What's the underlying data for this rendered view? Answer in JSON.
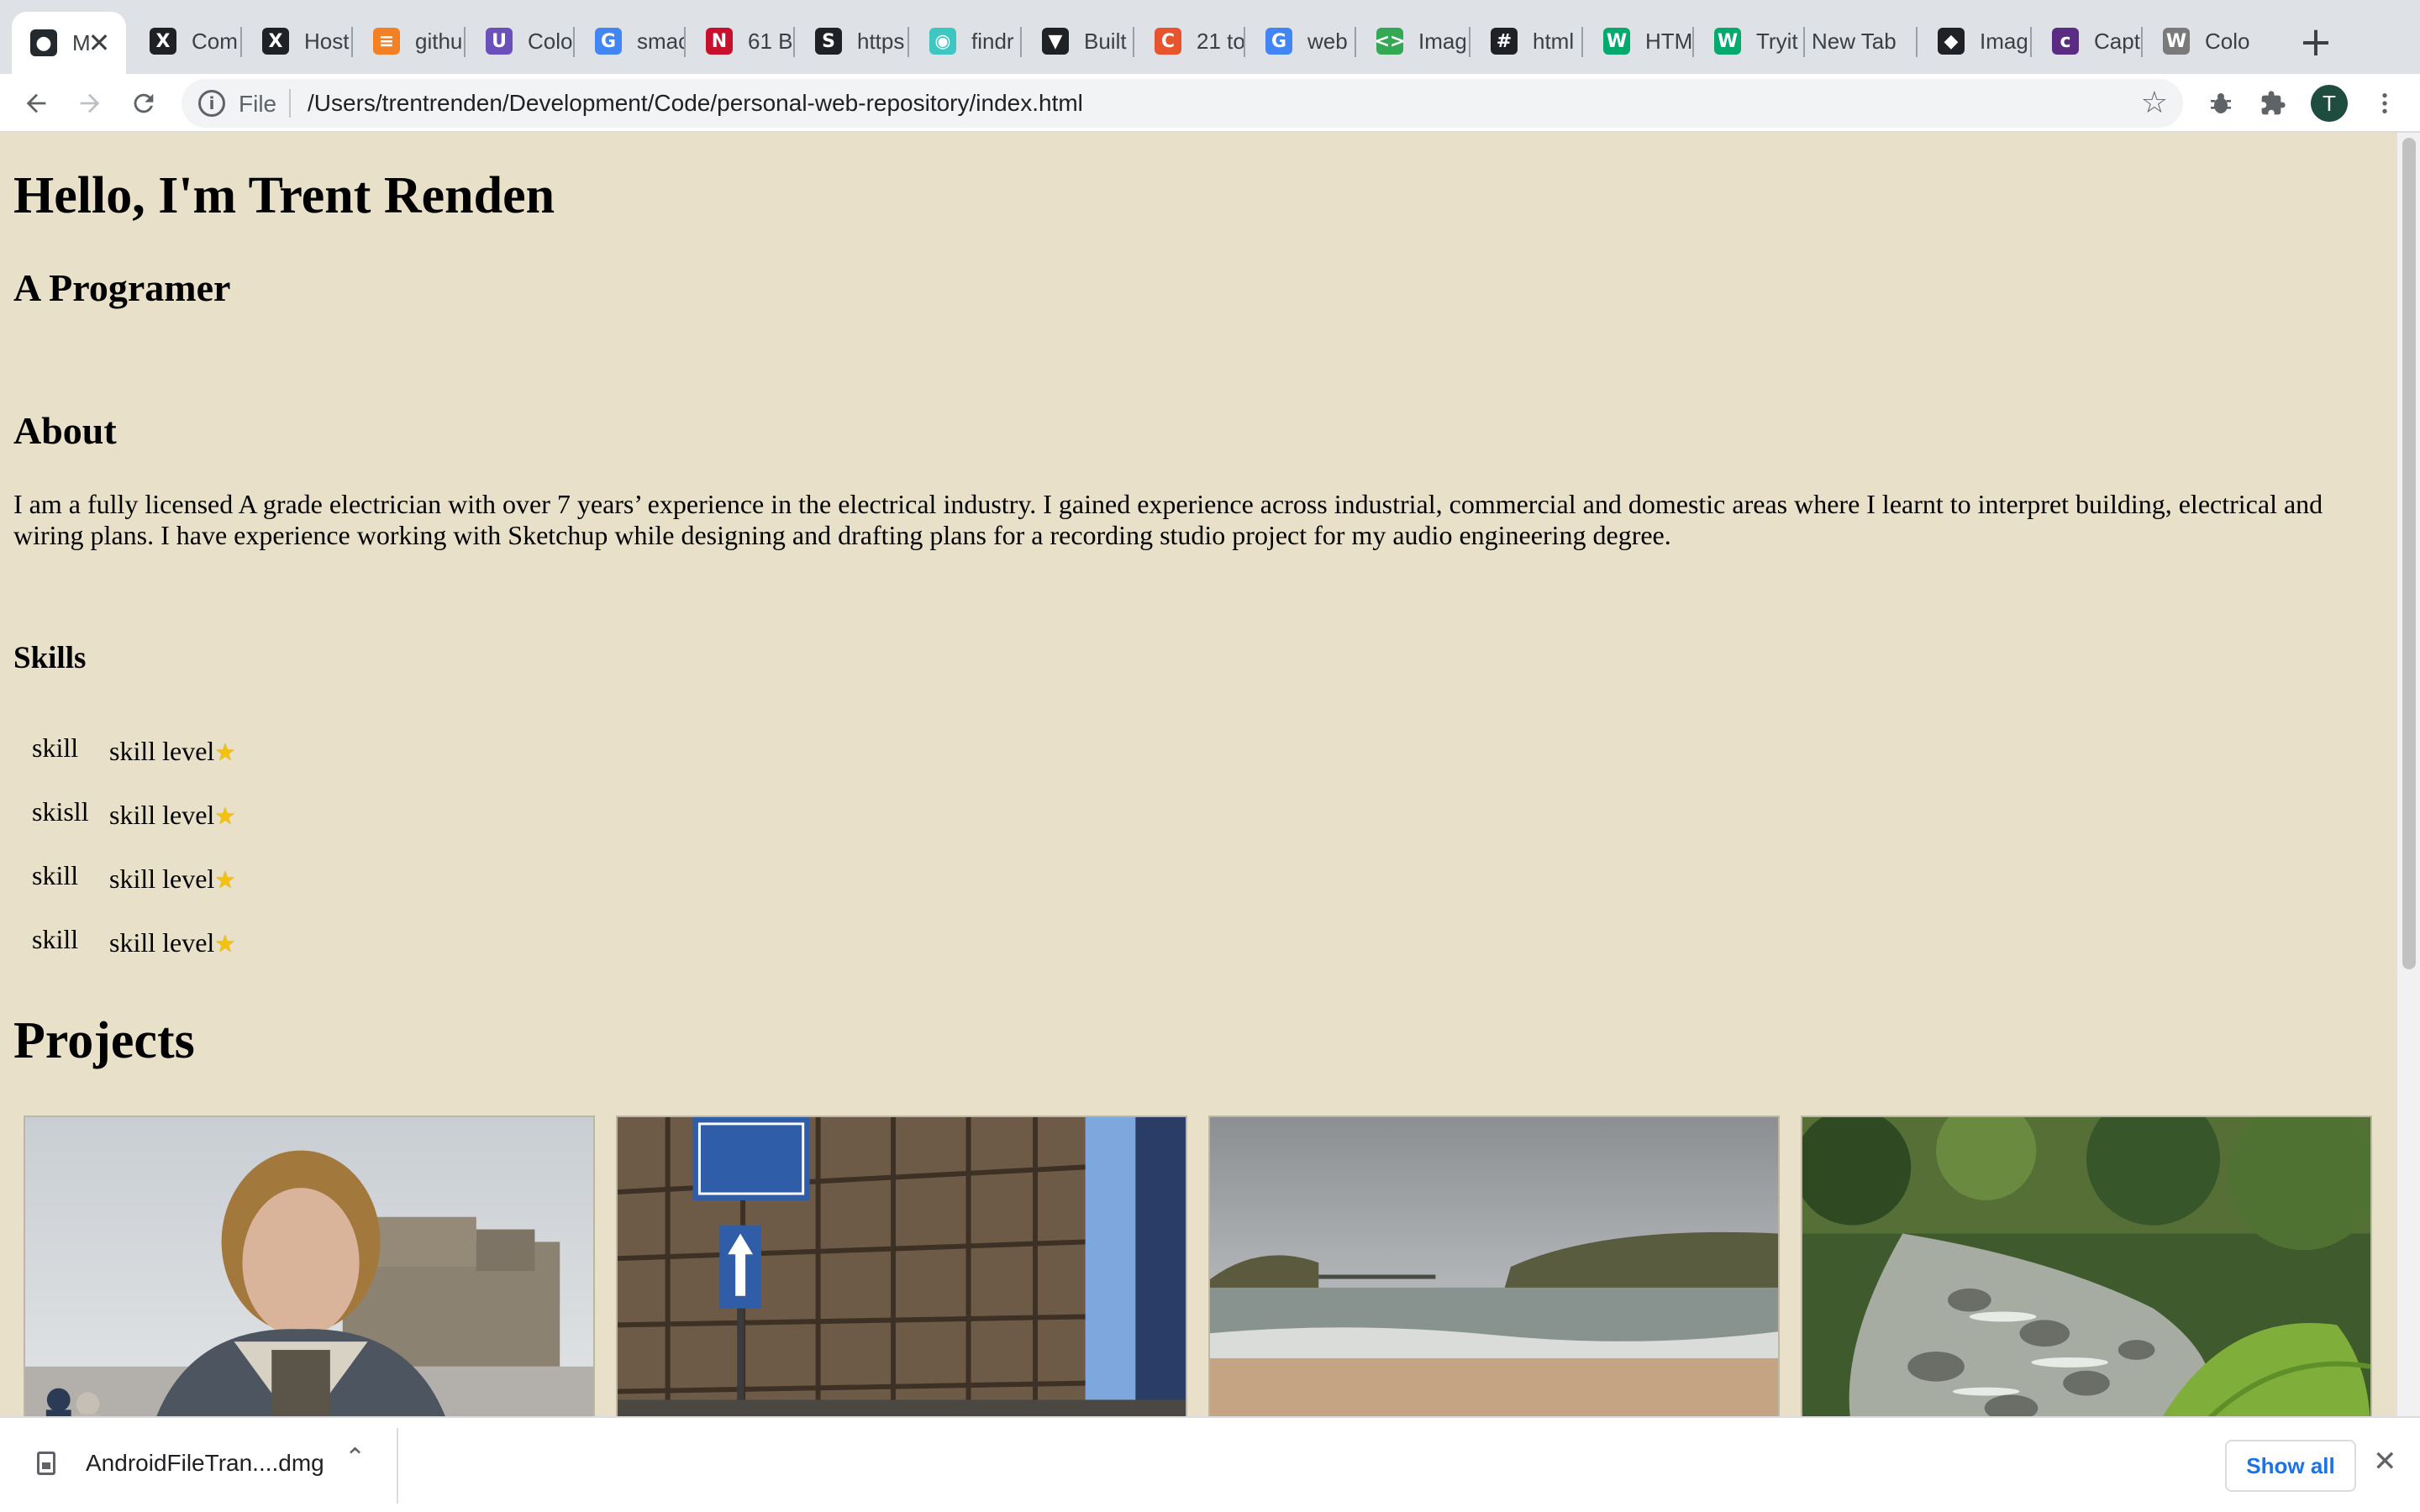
{
  "browser": {
    "tabs": [
      {
        "title": "M",
        "icon": "github-icon",
        "icon_bg": "#24292e",
        "icon_char": "●",
        "active": true
      },
      {
        "title": "Com",
        "icon": "x-logo-icon",
        "icon_bg": "#202124",
        "icon_char": "X"
      },
      {
        "title": "Host",
        "icon": "x-logo-icon",
        "icon_bg": "#202124",
        "icon_char": "X"
      },
      {
        "title": "githu",
        "icon": "stackoverflow-icon",
        "icon_bg": "#f48024",
        "icon_char": "≡"
      },
      {
        "title": "Colo",
        "icon": "color-cup-icon",
        "icon_bg": "#6b4fbb",
        "icon_char": "U"
      },
      {
        "title": "smac",
        "icon": "google-icon",
        "icon_bg": "#4285f4",
        "icon_char": "G"
      },
      {
        "title": "61 B",
        "icon": "red-logo-icon",
        "icon_bg": "#c8102e",
        "icon_char": "N"
      },
      {
        "title": "https",
        "icon": "s-logo-icon",
        "icon_bg": "#202124",
        "icon_char": "S"
      },
      {
        "title": "findr",
        "icon": "findr-icon",
        "icon_bg": "#3ec7c2",
        "icon_char": "◉"
      },
      {
        "title": "Built",
        "icon": "shield-icon",
        "icon_bg": "#202124",
        "icon_char": "▼"
      },
      {
        "title": "21 to",
        "icon": "css-logo-icon",
        "icon_bg": "#e8542d",
        "icon_char": "C"
      },
      {
        "title": "web",
        "icon": "google-icon",
        "icon_bg": "#4285f4",
        "icon_char": "G"
      },
      {
        "title": "Imag",
        "icon": "code-brackets-icon",
        "icon_bg": "#34a853",
        "icon_char": "<>"
      },
      {
        "title": "html",
        "icon": "grid-logo-icon",
        "icon_bg": "#202124",
        "icon_char": "#"
      },
      {
        "title": "HTM",
        "icon": "w3schools-icon",
        "icon_bg": "#04aa6d",
        "icon_char": "W"
      },
      {
        "title": "Tryit",
        "icon": "w3schools-icon",
        "icon_bg": "#04aa6d",
        "icon_char": "W"
      },
      {
        "title": "New Tab",
        "icon": "",
        "icon_bg": "",
        "icon_char": ""
      },
      {
        "title": "Imag",
        "icon": "brush-icon",
        "icon_bg": "#202124",
        "icon_char": "◆"
      },
      {
        "title": "Capt",
        "icon": "coloris-icon",
        "icon_bg": "#5b2c83",
        "icon_char": "c"
      },
      {
        "title": "Colo",
        "icon": "wordpress-icon",
        "icon_bg": "#7a7a7a",
        "icon_char": "W"
      }
    ],
    "address": {
      "scheme_label": "File",
      "url": "/Users/trentrenden/Development/Code/personal-web-repository/index.html"
    },
    "profile_initial": "T"
  },
  "page": {
    "background": "#e8e0c8",
    "title": "Hello, I'm Trent Renden",
    "subtitle": "A Programer",
    "about": {
      "heading": "About",
      "text": "I am a fully licensed A grade electrician with over 7 years’ experience in the electrical industry. I gained experience across industrial, commercial and domestic areas where I learnt to interpret building, electrical and wiring plans. I have experience working with Sketchup while designing and drafting plans for a recording studio project for my audio engineering degree."
    },
    "skills": {
      "heading": "Skills",
      "items": [
        {
          "name": "skill",
          "level": "skill level",
          "icon": "star-icon"
        },
        {
          "name": "skisll",
          "level": "skill level",
          "icon": "star-icon"
        },
        {
          "name": "skill",
          "level": "skill level",
          "icon": "star-icon"
        },
        {
          "name": "skill",
          "level": "skill level",
          "icon": "star-icon"
        }
      ]
    },
    "projects": {
      "heading": "Projects",
      "images": [
        {
          "subject": "person-at-castle"
        },
        {
          "subject": "street-scaffolding-signs"
        },
        {
          "subject": "beach-cove-pier"
        },
        {
          "subject": "forest-creek-ferns"
        }
      ]
    }
  },
  "downloads": {
    "file_name": "AndroidFileTran....dmg",
    "show_all_label": "Show all"
  }
}
